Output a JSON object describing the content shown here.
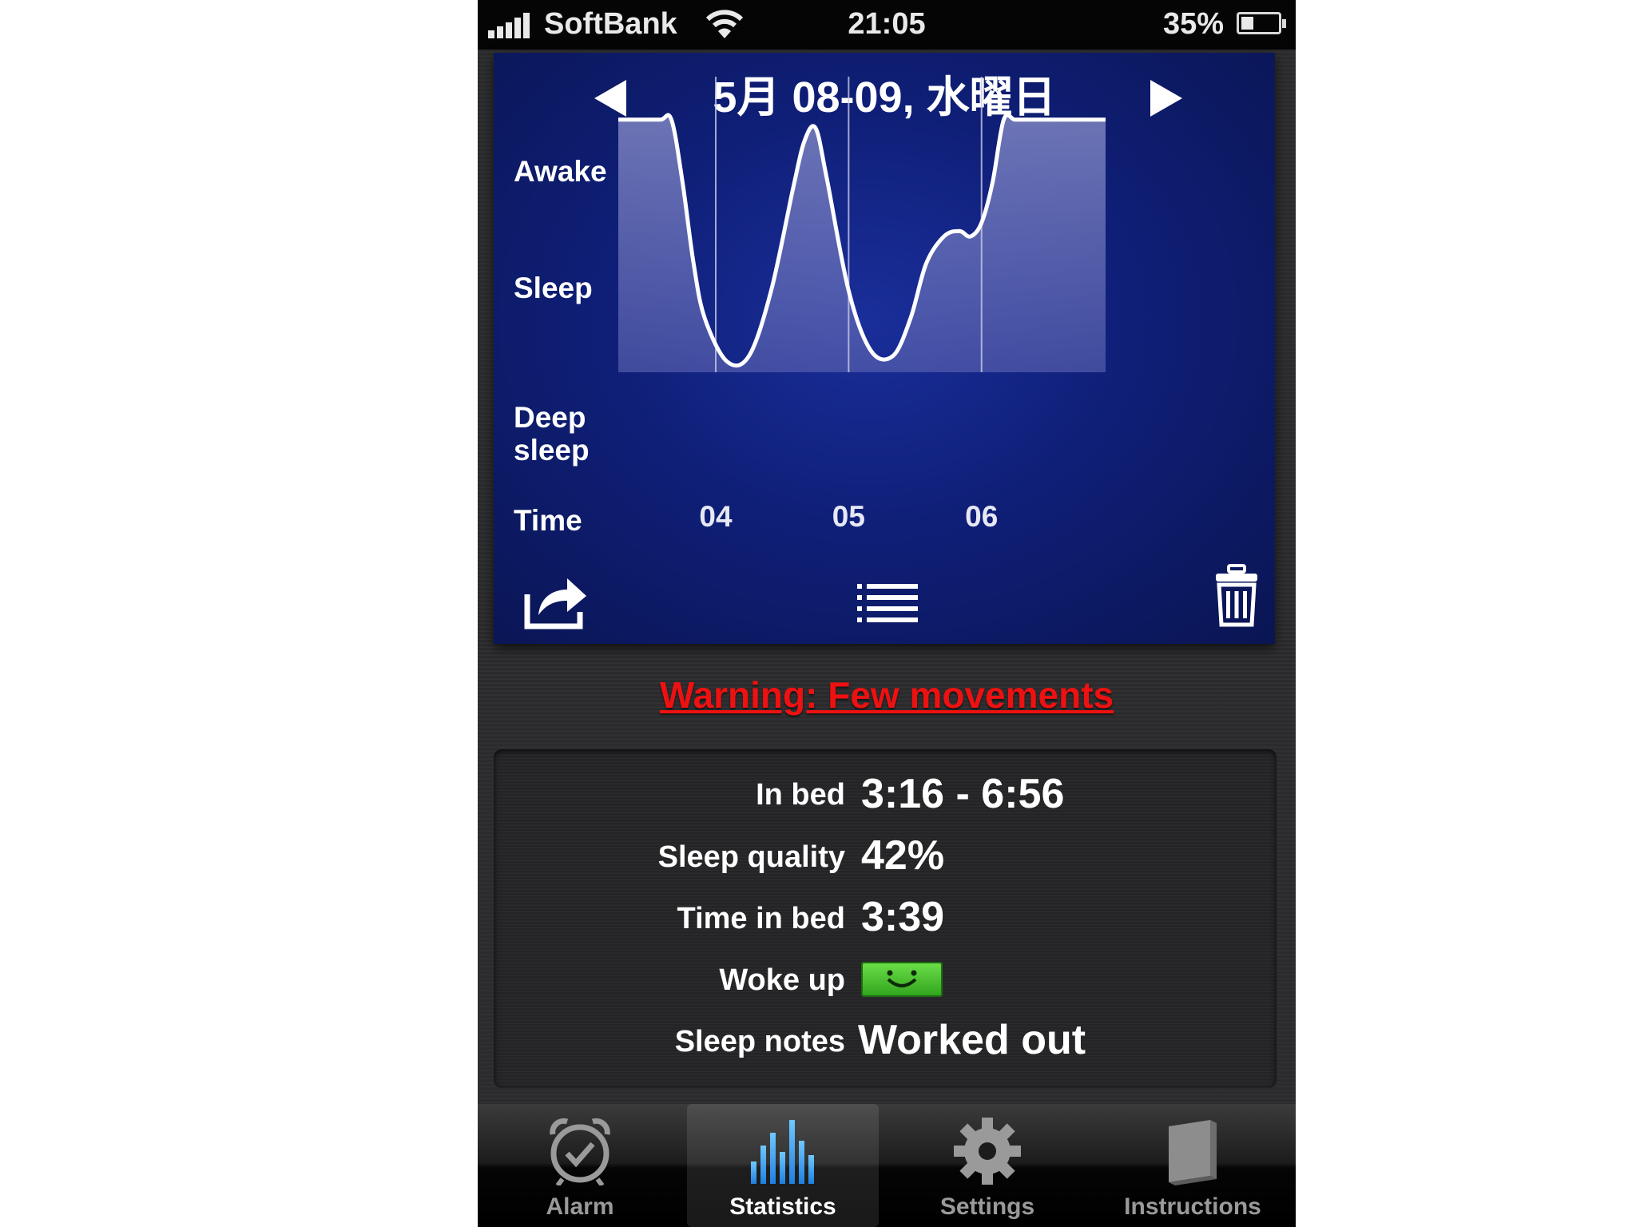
{
  "status_bar": {
    "carrier": "SoftBank",
    "time": "21:05",
    "battery": "35%",
    "battery_level": 0.35,
    "signal_icon": "signal-bars-icon",
    "wifi_icon": "wifi-icon",
    "battery_icon": "battery-icon"
  },
  "graph": {
    "date_title": "5月 08-09, 水曜日",
    "prev_icon": "triangle-left-icon",
    "next_icon": "triangle-right-icon",
    "y_labels": {
      "awake": "Awake",
      "sleep": "Sleep",
      "deep_line1": "Deep",
      "deep_line2": "sleep"
    },
    "time_label": "Time",
    "share_icon": "share-icon",
    "list_icon": "list-icon",
    "delete_icon": "trash-icon"
  },
  "chart_data": {
    "type": "area",
    "title": "",
    "xlabel": "Time",
    "ylabel": "",
    "x_ticks": [
      "04",
      "05",
      "06"
    ],
    "x_range": [
      "03:16",
      "06:56"
    ],
    "y_levels": [
      "Deep sleep",
      "Sleep",
      "Awake"
    ],
    "y_range": [
      0,
      1
    ],
    "grid": "vertical lines at each hour",
    "series": [
      {
        "x": [
          "03:16",
          "03:25",
          "03:35",
          "03:40",
          "03:45",
          "03:50",
          "03:55",
          "04:05",
          "04:15",
          "04:25",
          "04:35",
          "04:40",
          "04:45",
          "04:50",
          "05:00",
          "05:10",
          "05:20",
          "05:28",
          "05:35",
          "05:43",
          "05:50",
          "05:55",
          "06:00",
          "06:05",
          "06:10",
          "06:15",
          "06:20",
          "06:30",
          "06:40",
          "06:56"
        ],
        "values": [
          0.93,
          0.93,
          0.93,
          0.93,
          0.7,
          0.4,
          0.2,
          0.04,
          0.06,
          0.3,
          0.68,
          0.85,
          0.9,
          0.72,
          0.3,
          0.08,
          0.06,
          0.2,
          0.4,
          0.5,
          0.52,
          0.5,
          0.55,
          0.7,
          0.93,
          0.93,
          0.93,
          0.93,
          0.93,
          0.93
        ]
      }
    ]
  },
  "warning": {
    "text": "Warning: Few movements",
    "color": "#ee1111"
  },
  "stats": {
    "in_bed_label": "In bed",
    "in_bed_value": "3:16 - 6:56",
    "sleep_quality_label": "Sleep quality",
    "sleep_quality_value": "42%",
    "time_in_bed_label": "Time in bed",
    "time_in_bed_value": "3:39",
    "woke_up_label": "Woke up",
    "woke_up_icon": "happy-face-icon",
    "woke_up_color": "#3cb82a",
    "sleep_notes_label": "Sleep notes",
    "sleep_notes_value": "Worked out"
  },
  "tabs": [
    {
      "label": "Alarm",
      "icon": "alarm-clock-icon",
      "active": false
    },
    {
      "label": "Statistics",
      "icon": "bar-chart-icon",
      "active": true
    },
    {
      "label": "Settings",
      "icon": "gear-icon",
      "active": false
    },
    {
      "label": "Instructions",
      "icon": "book-icon",
      "active": false
    }
  ]
}
